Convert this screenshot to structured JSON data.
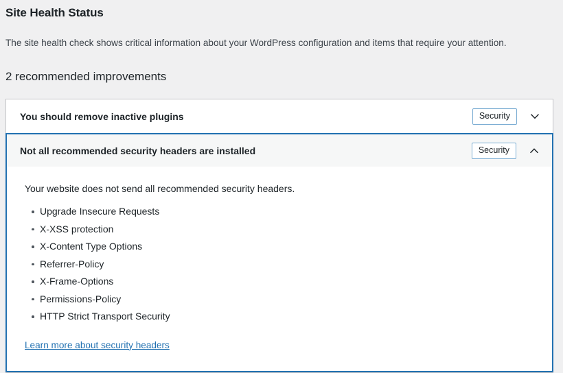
{
  "page": {
    "title": "Site Health Status",
    "description": "The site health check shows critical information about your WordPress configuration and items that require your attention.",
    "section_heading": "2 recommended improvements"
  },
  "colors": {
    "page_background": "#f0f0f1",
    "card_background": "#ffffff",
    "card_border": "#c3c4c7",
    "active_border": "#2271b1",
    "active_header_background": "#f6f7f7",
    "badge_border": "#7badd3",
    "link": "#2271b1",
    "text": "#1d2327"
  },
  "accordion": {
    "items": [
      {
        "title": "You should remove inactive plugins",
        "badge": "Security",
        "expanded": false,
        "toggle_icon": "chevron-down-icon"
      },
      {
        "title": "Not all recommended security headers are installed",
        "badge": "Security",
        "expanded": true,
        "toggle_icon": "chevron-up-icon",
        "panel": {
          "lead": "Your website does not send all recommended security headers.",
          "list": [
            "Upgrade Insecure Requests",
            "X-XSS protection",
            "X-Content Type Options",
            "Referrer-Policy",
            "X-Frame-Options",
            "Permissions-Policy",
            "HTTP Strict Transport Security"
          ],
          "link_label": "Learn more about security headers"
        }
      }
    ]
  }
}
